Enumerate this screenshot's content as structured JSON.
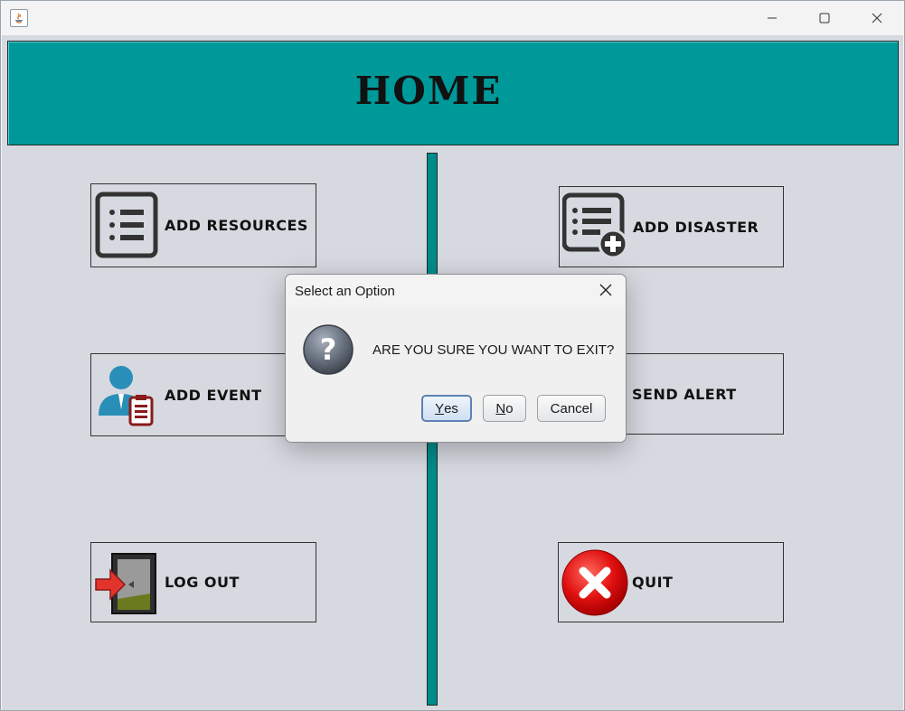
{
  "window": {
    "controls": {
      "minimize_icon": "minimize-icon",
      "maximize_icon": "maximize-icon",
      "close_icon": "close-icon"
    }
  },
  "header": {
    "title": "HOME"
  },
  "buttons": {
    "add_resources": "ADD RESOURCES",
    "add_disaster": "ADD DISASTER",
    "add_event": "ADD EVENT",
    "send_alert": "SEND ALERT",
    "log_out": "LOG OUT",
    "quit": "QUIT"
  },
  "dialog": {
    "title": "Select an Option",
    "message": "ARE YOU SURE YOU WANT TO EXIT?",
    "buttons": {
      "yes": {
        "mnemonic": "Y",
        "rest": "es"
      },
      "no": {
        "mnemonic": "N",
        "rest": "o"
      },
      "cancel": "Cancel"
    }
  },
  "colors": {
    "header_bg": "#009999",
    "content_bg": "#d6d9e0",
    "divider": "#008b8b",
    "quit_red": "#e01010"
  }
}
